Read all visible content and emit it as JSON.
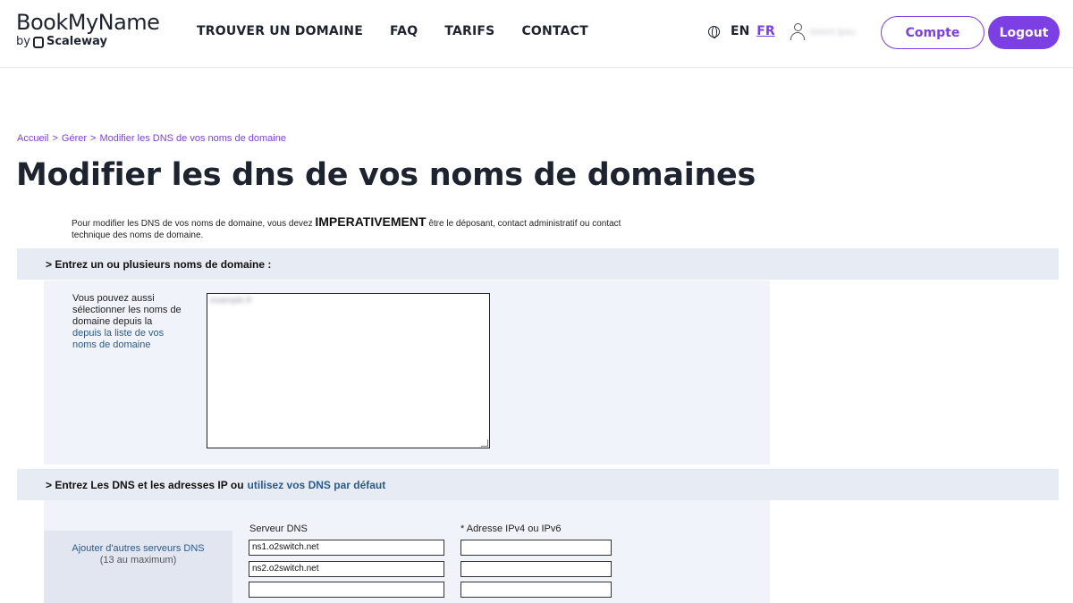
{
  "header": {
    "logo_main": "BookMyName",
    "logo_by": "by",
    "logo_scaleway": "Scaleway",
    "nav": [
      "TROUVER UN DOMAINE",
      "FAQ",
      "TARIFS",
      "CONTACT"
    ],
    "lang_en": "EN",
    "lang_fr": "FR",
    "user_name": "lorem ipsu",
    "compte_label": "Compte",
    "logout_label": "Logout"
  },
  "breadcrumb": {
    "items": [
      "Accueil",
      "Gérer",
      "Modifier les DNS de vos noms de domaine"
    ],
    "separator": ">"
  },
  "page_title": "Modifier les dns de vos noms de domaines",
  "intro": {
    "before": "Pour modifier les DNS de vos noms de domaine, vous devez ",
    "emphasis": "IMPERATIVEMENT",
    "after": " être le déposant, contact administratif ou contact technique des noms de domaine."
  },
  "section1": {
    "title": "> Entrez un ou plusieurs noms de domaine :",
    "side_text": "Vous pouvez aussi sélectionner les noms de domaine depuis la",
    "side_link": "depuis la liste de vos noms de domaine",
    "textarea_value": "example.fr"
  },
  "section2": {
    "title": "> Entrez Les DNS et les adresses IP ou",
    "title_link": "utilisez vos DNS par défaut",
    "add_link": "Ajouter d'autres serveurs DNS",
    "add_max": "(13 au maximum)",
    "col_dns": "Serveur DNS",
    "col_ip": "* Adresse IPv4 ou IPv6",
    "rows": [
      {
        "dns": "ns1.o2switch.net",
        "ip": ""
      },
      {
        "dns": "ns2.o2switch.net",
        "ip": ""
      },
      {
        "dns": "",
        "ip": ""
      }
    ]
  },
  "colors": {
    "accent": "#7b3fe4",
    "link": "#2c5a8f",
    "section_bg": "#e7ebf3",
    "panel_bg": "#f0f3f9"
  }
}
